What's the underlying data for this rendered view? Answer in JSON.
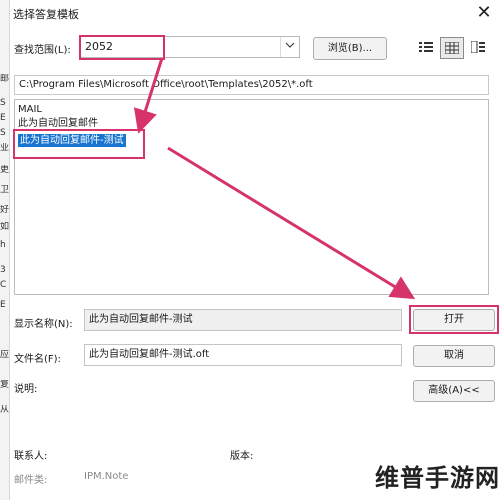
{
  "window": {
    "title": "选择答复模板",
    "close_glyph": "✕"
  },
  "side_fragments": [
    "邮",
    "S",
    "E",
    "S",
    "业",
    "更",
    "卫",
    "好",
    "如",
    "h",
    "3",
    "C",
    "E",
    "应",
    "复",
    "从"
  ],
  "look_in": {
    "label": "查找范围(L):",
    "value": "2052",
    "dropdown_glyph": "﹀"
  },
  "browse_label": "浏览(B)...",
  "view_buttons": [
    "list-view-icon",
    "details-view-icon",
    "properties-view-icon"
  ],
  "path": "C:\\Program Files\\Microsoft Office\\root\\Templates\\2052\\*.oft",
  "files": [
    "MAIL",
    "此为自动回复邮件",
    "此为自动回复邮件-测试"
  ],
  "selected_file_index": 2,
  "display_name": {
    "label": "显示名称(N):",
    "value": "此为自动回复邮件-测试"
  },
  "file_name": {
    "label": "文件名(F):",
    "value": "此为自动回复邮件-测试.oft"
  },
  "open_label": "打开",
  "cancel_label": "取消",
  "description_label": "说明:",
  "advanced_label": "高级(A)<<",
  "contact_label": "联系人:",
  "version_label": "版本:",
  "message_class_label": "邮件类:",
  "message_class_value": "IPM.Note",
  "watermark": "维普手游网",
  "colors": {
    "annotation": "#d6336c",
    "selection": "#1874d1"
  }
}
